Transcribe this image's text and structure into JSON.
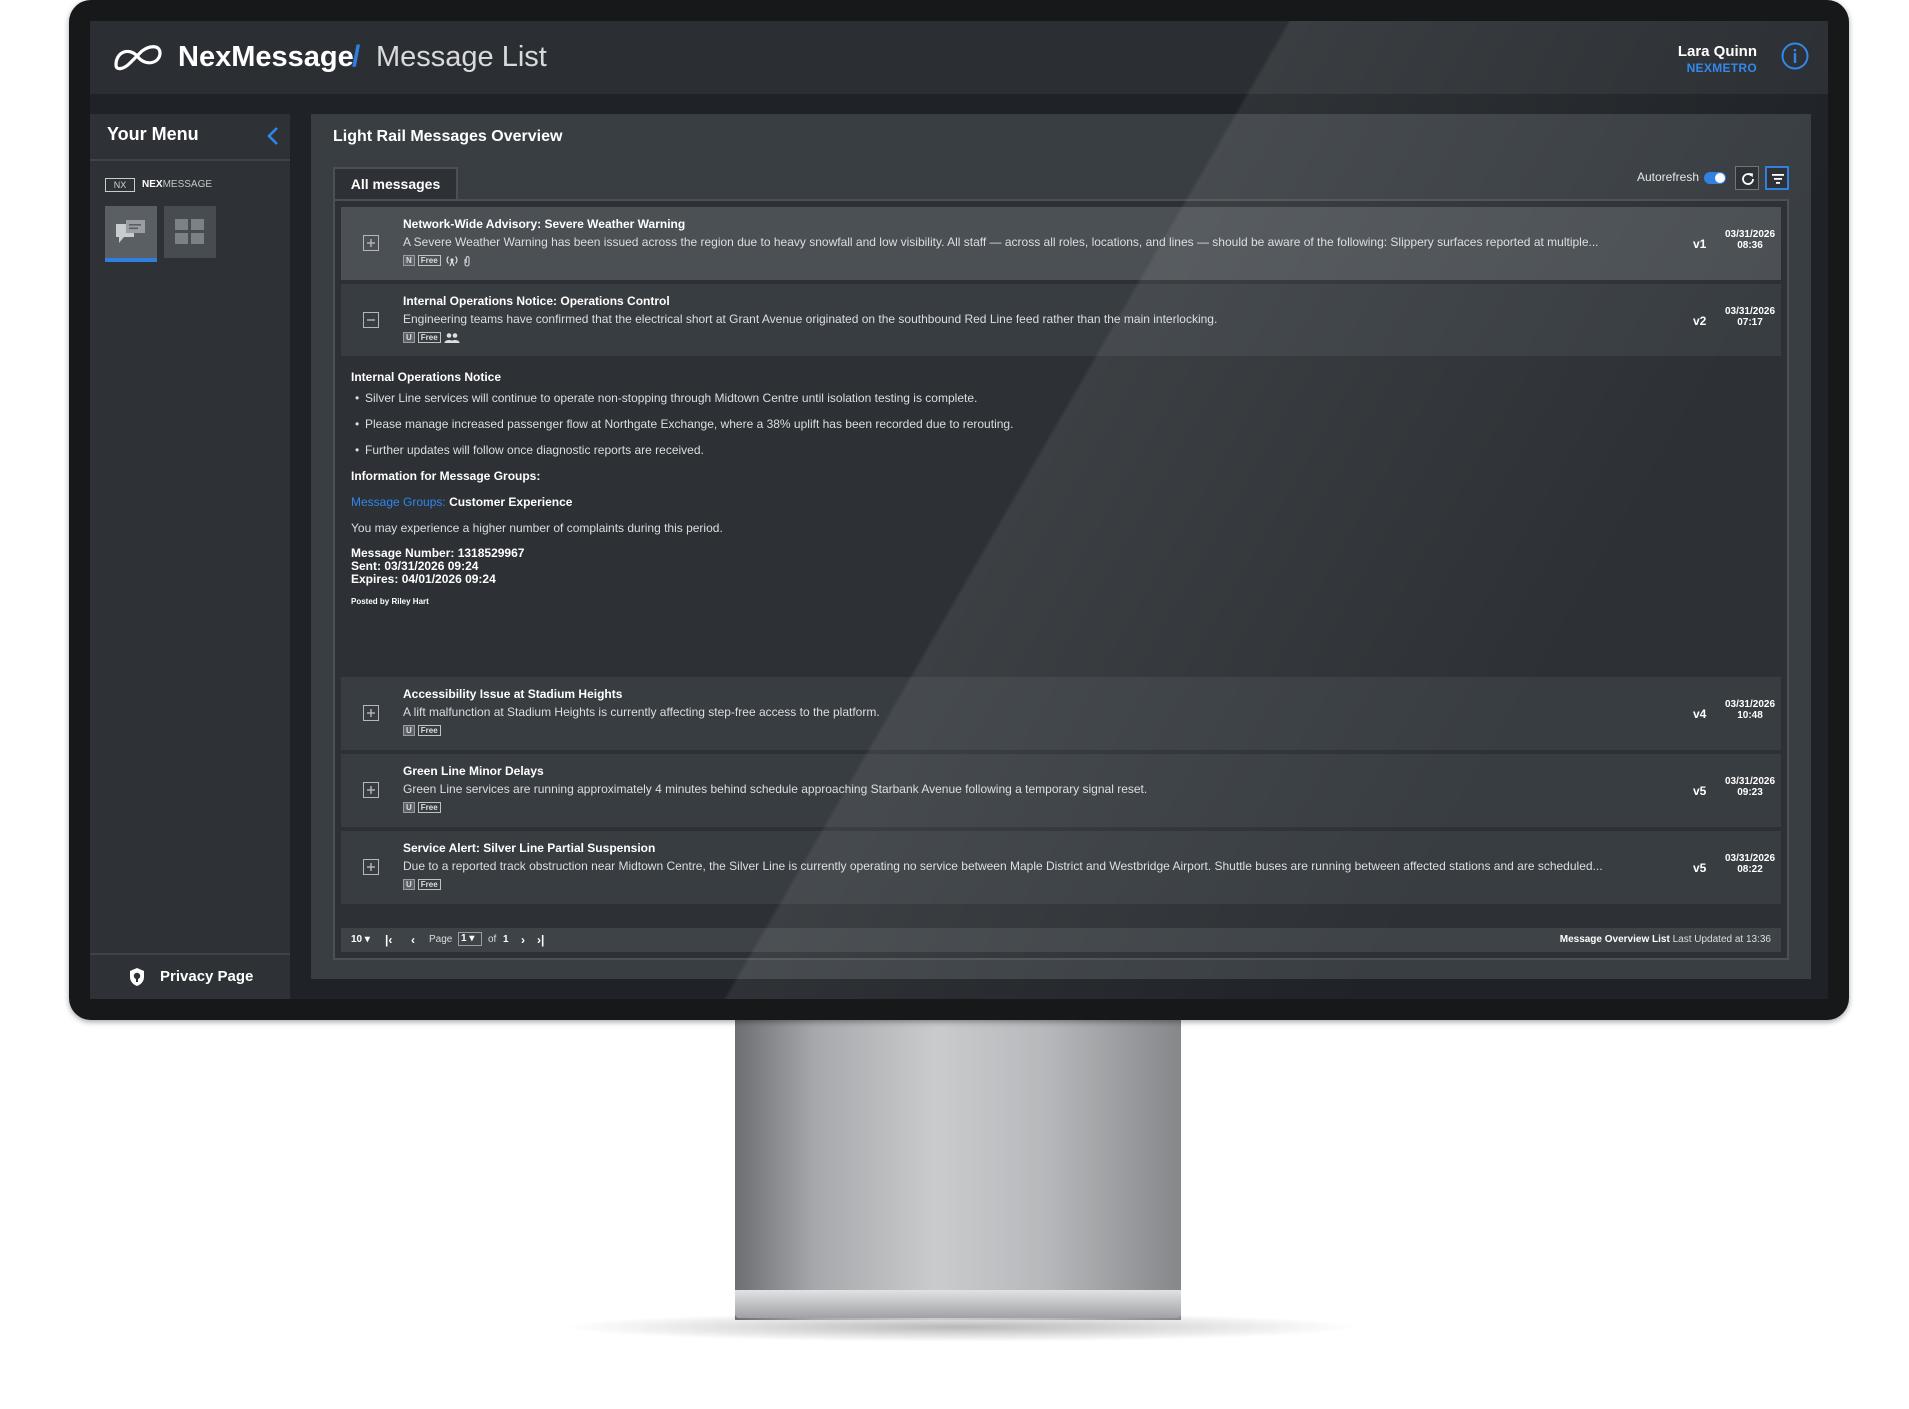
{
  "header": {
    "brand": "NexMessage",
    "slash": "/",
    "page_title": "Message List",
    "user_name": "Lara Quinn",
    "user_org": "NEXMETRO"
  },
  "sidebar": {
    "title": "Your Menu",
    "app_tag": "NX",
    "app_label_bold": "NEX",
    "app_label_rest": "MESSAGE",
    "tiles": [
      {
        "icon": "messages-icon",
        "active": true
      },
      {
        "icon": "grid-icon",
        "active": false
      }
    ],
    "privacy_label": "Privacy Page"
  },
  "main": {
    "title": "Light Rail Messages Overview",
    "tab_label": "All messages",
    "autorefresh_label": "Autorefresh",
    "autorefresh_on": true
  },
  "messages": [
    {
      "title": "Network-Wide Advisory: Severe Weather Warning",
      "body": "A Severe Weather Warning has been issued across the region due to heavy snowfall and low visibility. All staff — across all roles, locations, and lines — should be aware of the following: Slippery surfaces reported at multiple...",
      "tag_letter": "N",
      "tag_label": "Free",
      "extra_icons": [
        "broadcast-icon",
        "attachment-icon"
      ],
      "version": "v1",
      "date": "03/31/2026",
      "time": "08:36",
      "expanded": false,
      "highlight": true
    },
    {
      "title": "Internal Operations Notice: Operations Control",
      "body": "Engineering teams have confirmed that the electrical short at Grant Avenue originated on the southbound Red Line feed rather than the main interlocking.",
      "tag_letter": "U",
      "tag_label": "Free",
      "extra_icons": [
        "group-icon"
      ],
      "version": "v2",
      "date": "03/31/2026",
      "time": "07:17",
      "expanded": true,
      "highlight": false
    },
    {
      "title": "Accessibility Issue at Stadium Heights",
      "body": "A lift malfunction at Stadium Heights is currently affecting step-free access to the platform.",
      "tag_letter": "U",
      "tag_label": "Free",
      "extra_icons": [],
      "version": "v4",
      "date": "03/31/2026",
      "time": "10:48",
      "expanded": false,
      "highlight": false
    },
    {
      "title": "Green Line Minor Delays",
      "body": "Green Line services are running approximately 4 minutes behind schedule approaching Starbank Avenue following a temporary signal reset.",
      "tag_letter": "U",
      "tag_label": "Free",
      "extra_icons": [],
      "version": "v5",
      "date": "03/31/2026",
      "time": "09:23",
      "expanded": false,
      "highlight": false
    },
    {
      "title": "Service Alert: Silver Line Partial Suspension",
      "body": "Due to a reported track obstruction near Midtown Centre, the Silver Line is currently operating no service between Maple District and Westbridge Airport. Shuttle buses are running between affected stations and are scheduled...",
      "tag_letter": "U",
      "tag_label": "Free",
      "extra_icons": [],
      "version": "v5",
      "date": "03/31/2026",
      "time": "08:22",
      "expanded": false,
      "highlight": false
    }
  ],
  "detail": {
    "heading": "Internal Operations Notice",
    "bullets": [
      "Silver Line services will continue to operate non-stopping through Midtown Centre until isolation testing is complete.",
      "Please manage increased passenger flow at Northgate Exchange, where a 38% uplift has been recorded due to rerouting.",
      "Further updates will follow once diagnostic reports are received."
    ],
    "groups_heading": "Information for Message Groups:",
    "groups_link": "Message Groups:",
    "groups_value": "Customer Experience",
    "groups_note": "You may experience a higher number of complaints during this period.",
    "message_number": "Message Number: 1318529967",
    "sent": "Sent: 03/31/2026 09:24",
    "expires": "Expires: 04/01/2026 09:24",
    "posted_by": "Posted by Riley Hart"
  },
  "pager": {
    "page_size": "10",
    "page_word": "Page",
    "current_page": "1",
    "of_word": "of",
    "total_pages": "1",
    "status_bold": "Message Overview List",
    "status_rest": "Last Updated at 13:36"
  },
  "colors": {
    "accent": "#2f7fe0",
    "background": "#1f2327",
    "panel": "#393e43"
  }
}
